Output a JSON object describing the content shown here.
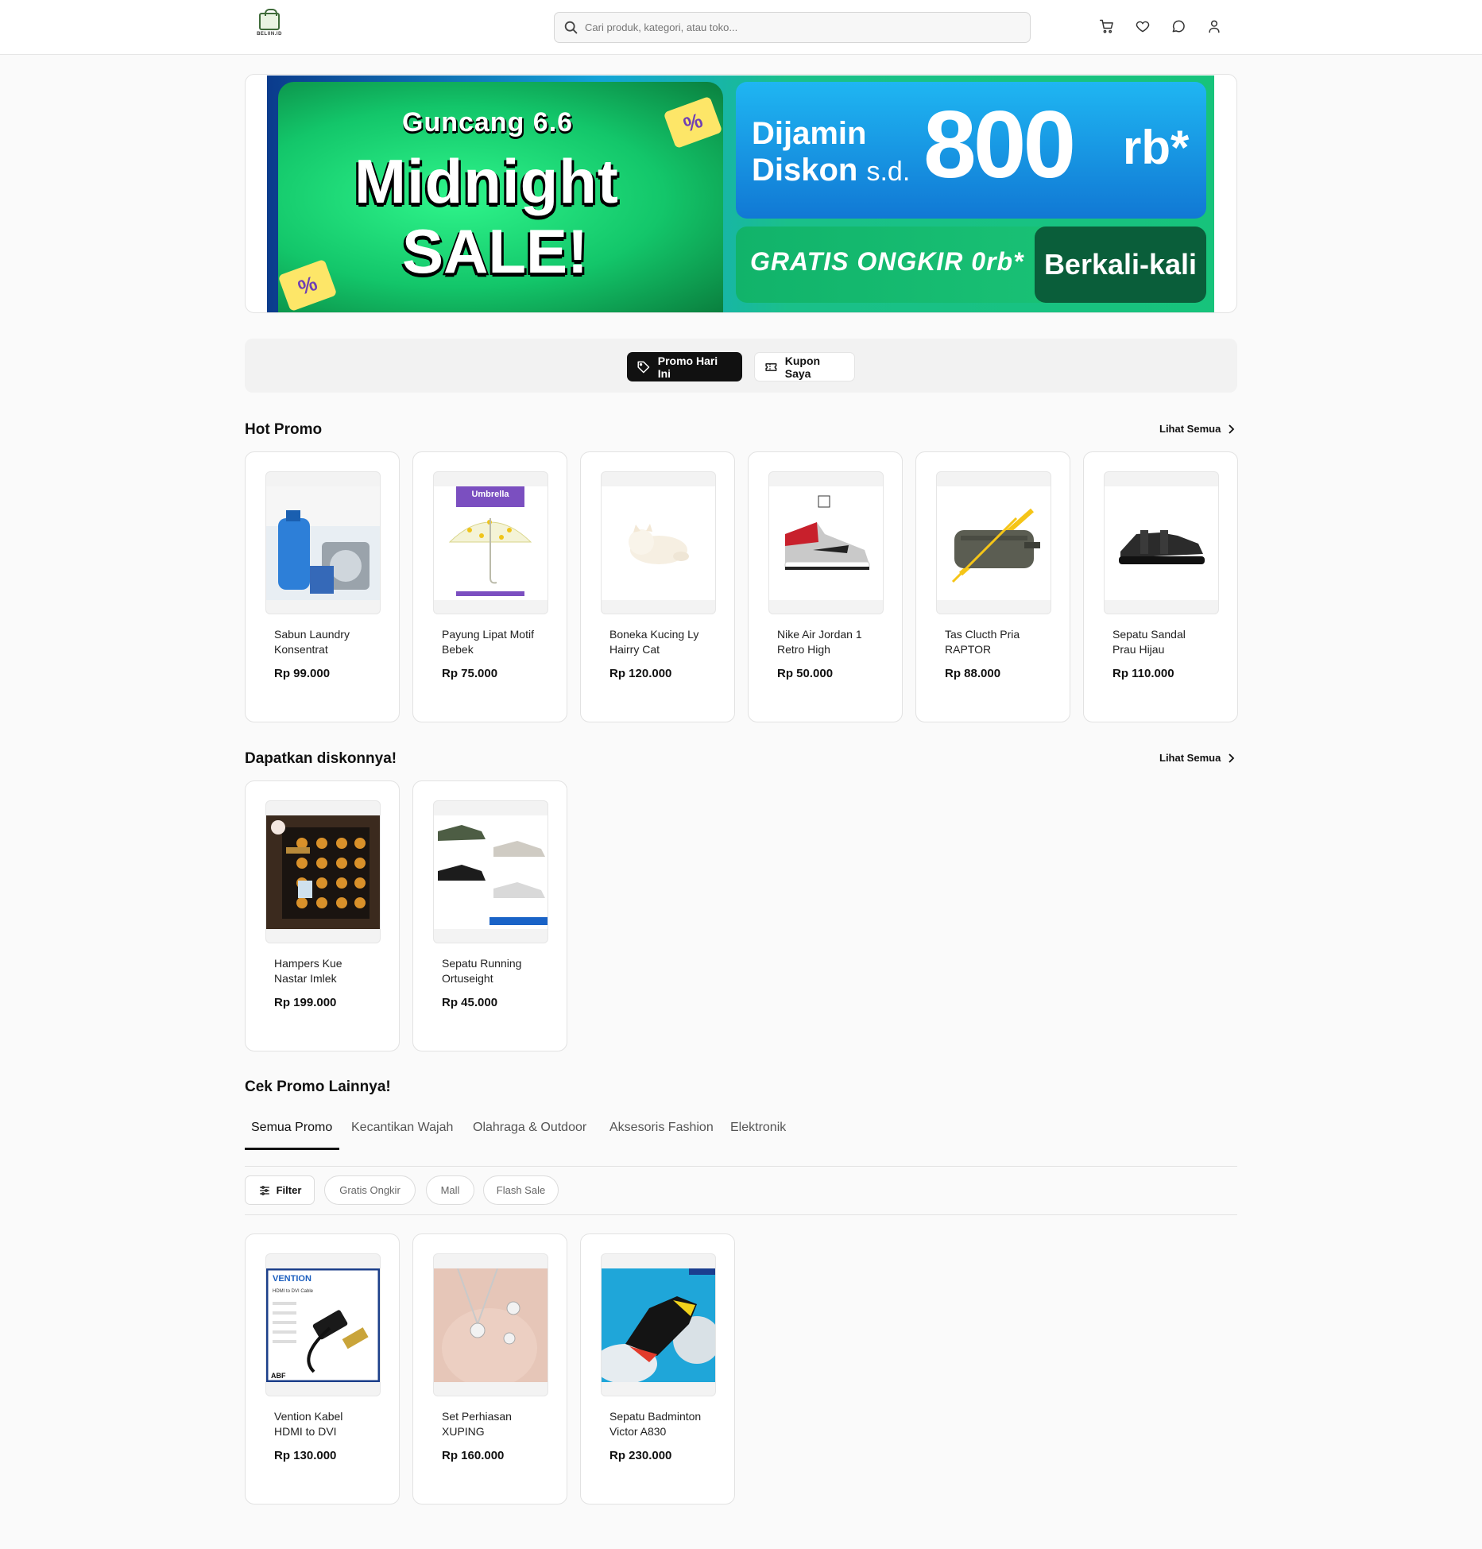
{
  "header": {
    "logo_text": "BELIIN.ID",
    "search_placeholder": "Cari produk, kategori, atau toko...",
    "icons": [
      "cart-icon",
      "heart-icon",
      "chat-icon",
      "user-icon"
    ]
  },
  "banner": {
    "line1": "Guncang 6.6",
    "line2": "Midnight",
    "line3": "SALE!",
    "tag_symbol": "%",
    "dijamin": "Dijamin",
    "diskon": "Diskon",
    "sd": "s.d.",
    "amount": "800",
    "amount_unit": "rb*",
    "gratis_ongkir": "GRATIS ONGKIR 0rb*",
    "berkali": "Berkali-kali"
  },
  "promo_tabs": {
    "promo_hari_ini": "Promo Hari Ini",
    "kupon_saya": "Kupon Saya"
  },
  "hot_promo": {
    "title": "Hot Promo",
    "see_all": "Lihat Semua",
    "products": [
      {
        "name": "Sabun Laundry Konsentrat",
        "price": "Rp 99.000"
      },
      {
        "name": "Payung Lipat Motif Bebek",
        "price": "Rp 75.000"
      },
      {
        "name": "Boneka Kucing Ly Hairry Cat",
        "price": "Rp 120.000"
      },
      {
        "name": "Nike Air Jordan 1 Retro High",
        "price": "Rp 50.000"
      },
      {
        "name": "Tas Clucth Pria RAPTOR",
        "price": "Rp 88.000"
      },
      {
        "name": "Sepatu Sandal Prau Hijau",
        "price": "Rp 110.000"
      }
    ]
  },
  "diskon": {
    "title": "Dapatkan diskonnya!",
    "see_all": "Lihat Semua",
    "products": [
      {
        "name": "Hampers Kue Nastar Imlek",
        "price": "Rp 199.000"
      },
      {
        "name": "Sepatu Running Ortuseight",
        "price": "Rp 45.000"
      }
    ]
  },
  "cek_promo": {
    "title": "Cek Promo Lainnya!",
    "tabs": [
      "Semua Promo",
      "Kecantikan Wajah",
      "Olahraga & Outdoor",
      "Aksesoris Fashion",
      "Elektronik"
    ],
    "active_tab": "Semua Promo",
    "filter_label": "Filter",
    "chips": [
      "Gratis Ongkir",
      "Mall",
      "Flash Sale"
    ],
    "products": [
      {
        "name": "Vention Kabel HDMI to DVI",
        "price": "Rp 130.000"
      },
      {
        "name": "Set Perhiasan XUPING",
        "price": "Rp 160.000"
      },
      {
        "name": "Sepatu Badminton Victor A830",
        "price": "Rp 230.000"
      }
    ]
  },
  "image_text": {
    "umbrella": "Umbrella",
    "vention": "VENTION",
    "vention_sub": "HDMI to DVI Cable",
    "vention_abf": "ABF"
  },
  "colors": {
    "accent_dark": "#111111",
    "page_bg": "#fafafa",
    "card_border": "#e2e2e2"
  }
}
